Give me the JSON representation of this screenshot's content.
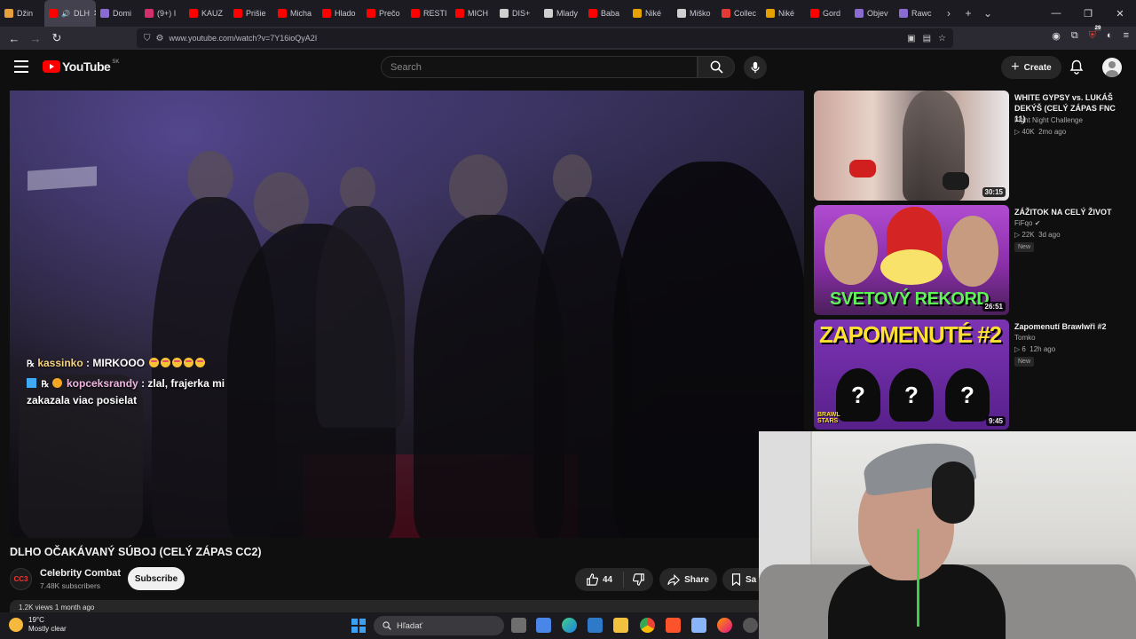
{
  "browser": {
    "tabs": [
      {
        "label": "Džin",
        "color": "#e8a13a"
      },
      {
        "label": "DLH",
        "color": "#ff0000",
        "active": true
      },
      {
        "label": "Domi",
        "color": "#8a6bd1"
      },
      {
        "label": "(9+) I",
        "color": "#d1306c"
      },
      {
        "label": "KAUZ",
        "color": "#ff0000"
      },
      {
        "label": "Prišie",
        "color": "#ff0000"
      },
      {
        "label": "Micha",
        "color": "#ff0000"
      },
      {
        "label": "Hlado",
        "color": "#ff0000"
      },
      {
        "label": "Prečo",
        "color": "#ff0000"
      },
      {
        "label": "RESTI",
        "color": "#ff0000"
      },
      {
        "label": "MICH",
        "color": "#ff0000"
      },
      {
        "label": "DIS+",
        "color": "#cfcfcf"
      },
      {
        "label": "Mlady",
        "color": "#cfcfcf"
      },
      {
        "label": "Baba",
        "color": "#ff0000"
      },
      {
        "label": "Niké",
        "color": "#e5a100"
      },
      {
        "label": "Miško",
        "color": "#cfcfcf"
      },
      {
        "label": "Collec",
        "color": "#e53935"
      },
      {
        "label": "Niké",
        "color": "#e5a100"
      },
      {
        "label": "Gord",
        "color": "#ff0000"
      },
      {
        "label": "Objev",
        "color": "#8a6bd1"
      },
      {
        "label": "Rawc",
        "color": "#8a6bd1"
      }
    ],
    "url": "www.youtube.com/watch?v=7Y16ioQyA2I",
    "ext_badge": "29"
  },
  "youtube": {
    "logo_text": "YouTube",
    "country_code": "SK",
    "search_placeholder": "Search",
    "create_label": "Create"
  },
  "video": {
    "chat": [
      {
        "user": "kassinko",
        "message": ": MIRKOOO"
      },
      {
        "user": "kopceksrandy",
        "message": ": zlal, frajerka mi",
        "message2": "zakazala viac posielat"
      }
    ],
    "title": "DLHO OČAKÁVANÝ SÚBOJ (CELÝ ZÁPAS CC2)",
    "channel": "Celebrity Combat",
    "channel_logo": "CC3",
    "subscribers": "7.48K subscribers",
    "subscribe_label": "Subscribe",
    "likes": "44",
    "share_label": "Share",
    "save_label": "Sa",
    "desc_partial": "1.2K views  1 month ago"
  },
  "recommendations": [
    {
      "title": "WHITE GYPSY vs. LUKÁŠ DEKÝŠ (CELÝ ZÁPAS FNC 11)",
      "channel": "Fight Night Challenge",
      "views": "40K",
      "age": "2mo ago",
      "duration": "30:15",
      "verified": false,
      "new": false
    },
    {
      "title": "ZÁŽITOK NA CELÝ ŽIVOT",
      "channel": "FiFqo",
      "views": "22K",
      "age": "3d ago",
      "duration": "26:51",
      "verified": true,
      "new": true,
      "thumb_text": "SVETOVÝ REKORD"
    },
    {
      "title": "Zapomenutí Brawlwři #2",
      "channel": "Tomko",
      "views": "6",
      "age": "12h ago",
      "duration": "9:45",
      "verified": false,
      "new": true,
      "thumb_text": "ZAPOMENUTÉ #2",
      "thumb_text2": "BRAWL STARS"
    }
  ],
  "new_badge": "New",
  "taskbar": {
    "temperature": "19°C",
    "weather": "Mostly clear",
    "search_label": "Hľadať"
  },
  "colors": {
    "yt_red": "#ff0000",
    "bg": "#0f0f0f",
    "chip": "#272727",
    "tab_active": "#42414d",
    "webcam_cable": "#3ecf4a"
  }
}
